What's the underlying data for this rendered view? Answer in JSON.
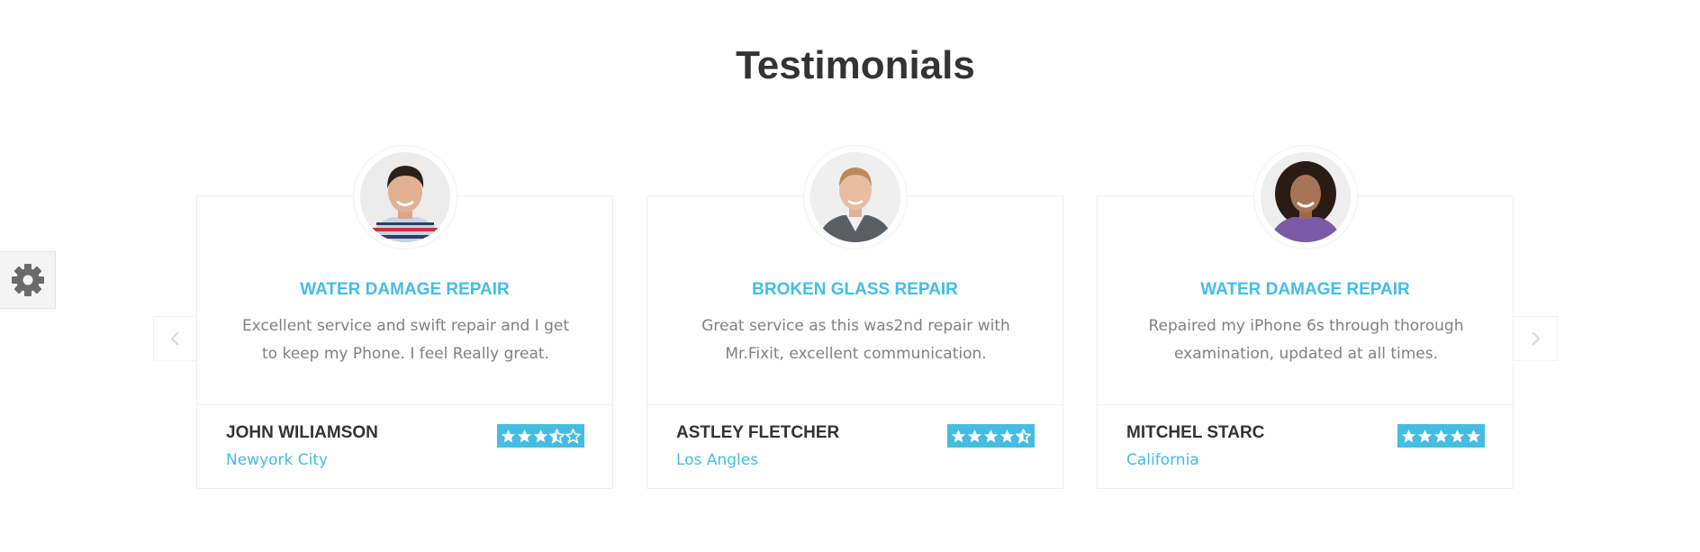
{
  "section": {
    "title": "Testimonials"
  },
  "settings": {
    "icon": "gear-icon"
  },
  "navigation": {
    "prev_icon": "chevron-left-icon",
    "next_icon": "chevron-right-icon"
  },
  "colors": {
    "accent": "#45bde3",
    "heading": "#333333",
    "body_text": "#808080",
    "border": "#f0f0f0"
  },
  "testimonials": [
    {
      "service": "WATER DAMAGE REPAIR",
      "text": "Excellent service and swift repair and I get to keep my Phone. I feel Really great.",
      "name": "JOHN WILIAMSON",
      "location": "Newyork City",
      "rating": 3.5,
      "avatar": "man-portrait-striped-shirt"
    },
    {
      "service": "BROKEN GLASS REPAIR",
      "text": "Great service as this was2nd repair with Mr.Fixit, excellent communication.",
      "name": "ASTLEY FLETCHER",
      "location": "Los Angles",
      "rating": 4.5,
      "avatar": "man-portrait-blazer"
    },
    {
      "service": "WATER DAMAGE REPAIR",
      "text": "Repaired my iPhone 6s through thorough examination, updated at all times.",
      "name": "MITCHEL STARC",
      "location": "California",
      "rating": 5,
      "avatar": "woman-portrait-curly-hair"
    }
  ]
}
